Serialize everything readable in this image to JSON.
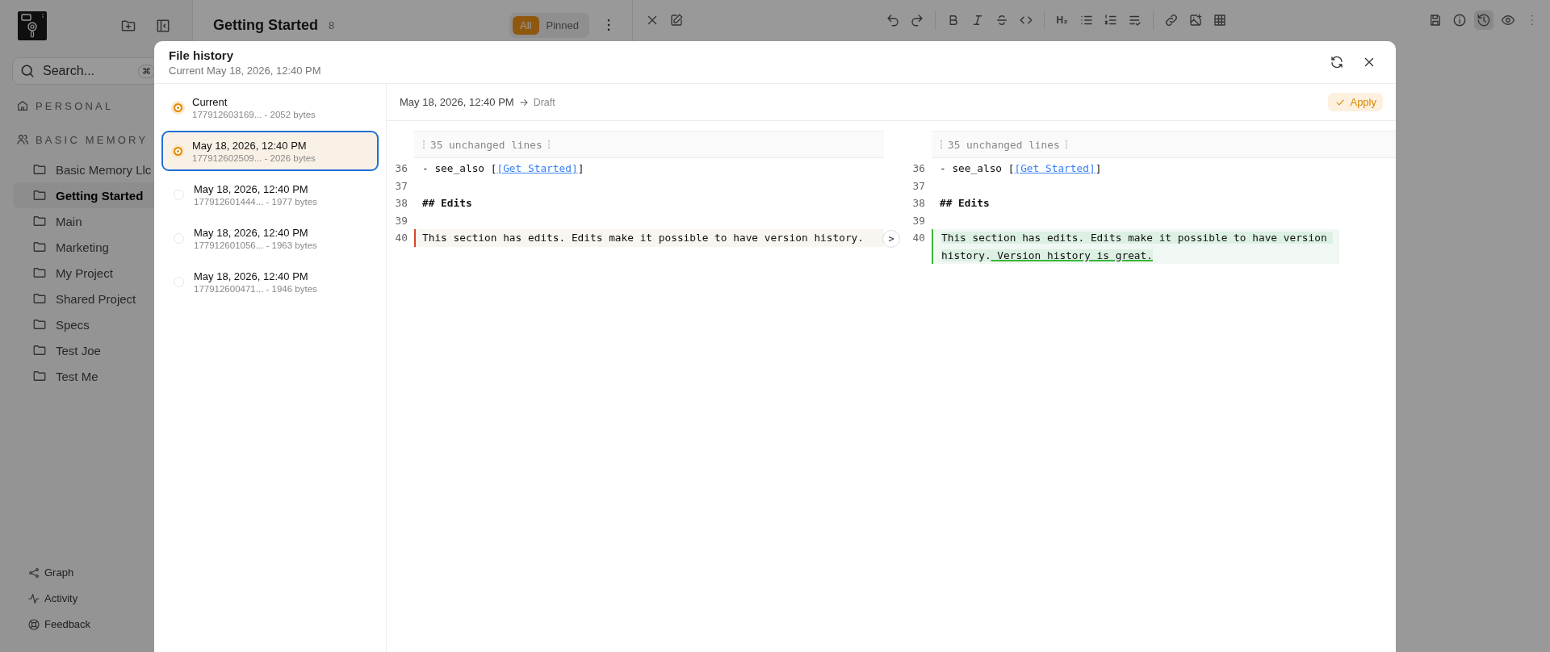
{
  "sidebar": {
    "search": {
      "placeholder": "Search...",
      "shortcut": "⌘"
    },
    "sections": [
      {
        "label": "PERSONAL",
        "kind": "home"
      },
      {
        "label": "BASIC MEMORY",
        "kind": "users"
      }
    ],
    "projects": [
      {
        "name": "Basic Memory Llc",
        "selected": false
      },
      {
        "name": "Getting Started",
        "selected": true
      },
      {
        "name": "Main",
        "selected": false
      },
      {
        "name": "Marketing",
        "selected": false
      },
      {
        "name": "My Project",
        "selected": false
      },
      {
        "name": "Shared Project",
        "selected": false
      },
      {
        "name": "Specs",
        "selected": false
      },
      {
        "name": "Test Joe",
        "selected": false
      },
      {
        "name": "Test Me",
        "selected": false
      }
    ],
    "footer": [
      {
        "label": "Graph",
        "kind": "graph"
      },
      {
        "label": "Activity",
        "kind": "activity"
      },
      {
        "label": "Feedback",
        "kind": "lifebuoy"
      }
    ]
  },
  "notes_header": {
    "title": "Getting Started",
    "count": "8",
    "filters": [
      {
        "label": "All",
        "selected": true
      },
      {
        "label": "Pinned",
        "selected": false
      }
    ]
  },
  "toolbar": {
    "left": [
      {
        "kind": "close",
        "selected": false
      },
      {
        "kind": "edit",
        "selected": false
      }
    ],
    "groups": [
      [
        {
          "kind": "undo",
          "selected": false
        },
        {
          "kind": "redo",
          "selected": false
        }
      ],
      [
        {
          "kind": "bold",
          "selected": false
        },
        {
          "kind": "italic",
          "selected": false
        },
        {
          "kind": "strike",
          "selected": false
        },
        {
          "kind": "code",
          "selected": false
        }
      ],
      [
        {
          "kind": "heading",
          "label": "H₂",
          "selected": false
        },
        {
          "kind": "bullets",
          "selected": false
        },
        {
          "kind": "numbers",
          "selected": false
        },
        {
          "kind": "checklist",
          "selected": false
        }
      ],
      [
        {
          "kind": "link",
          "selected": false
        },
        {
          "kind": "image",
          "selected": false
        },
        {
          "kind": "table",
          "selected": false
        }
      ]
    ],
    "right": [
      {
        "kind": "save",
        "selected": false
      },
      {
        "kind": "info",
        "selected": false
      },
      {
        "kind": "history",
        "selected": true
      },
      {
        "kind": "eye",
        "selected": false
      },
      {
        "kind": "kebab",
        "selected": false
      }
    ]
  },
  "dialog": {
    "title": "File history",
    "subtitle": "Current May 18, 2026, 12:40 PM",
    "versions": [
      {
        "title": "Current",
        "detail": "177912603169... - 2052 bytes",
        "checked": true,
        "selected": false
      },
      {
        "title": "May 18, 2026, 12:40 PM",
        "detail": "177912602509... - 2026 bytes",
        "checked": true,
        "selected": true
      },
      {
        "title": "May 18, 2026, 12:40 PM",
        "detail": "177912601444... - 1977 bytes",
        "checked": false,
        "selected": false
      },
      {
        "title": "May 18, 2026, 12:40 PM",
        "detail": "177912601056... - 1963 bytes",
        "checked": false,
        "selected": false
      },
      {
        "title": "May 18, 2026, 12:40 PM",
        "detail": "177912600471... - 1946 bytes",
        "checked": false,
        "selected": false
      }
    ],
    "compare": {
      "from": "May 18, 2026, 12:40 PM",
      "to": "Draft",
      "apply": "Apply"
    },
    "diff": {
      "expand": ">",
      "panes": [
        {
          "collapsed": "35 unchanged lines",
          "lines": [
            {
              "number": "36",
              "kind": "link",
              "before": "- see_also [",
              "link": "[Get Started]",
              "after": "]"
            },
            {
              "number": "37",
              "kind": "blank"
            },
            {
              "number": "38",
              "kind": "heading",
              "text": "## Edits"
            },
            {
              "number": "39",
              "kind": "blank"
            },
            {
              "number": "40",
              "kind": "removed",
              "text": "This section has edits. Edits make it possible to have version history."
            }
          ]
        },
        {
          "collapsed": "35 unchanged lines",
          "lines": [
            {
              "number": "36",
              "kind": "link",
              "before": "- see_also [",
              "link": "[Get Started]",
              "after": "]"
            },
            {
              "number": "37",
              "kind": "blank"
            },
            {
              "number": "38",
              "kind": "heading",
              "text": "## Edits"
            },
            {
              "number": "39",
              "kind": "blank"
            },
            {
              "number": "40",
              "kind": "added",
              "text": "This section has edits. Edits make it possible to have version history.",
              "inserted": " Version history is great."
            }
          ]
        }
      ]
    }
  }
}
